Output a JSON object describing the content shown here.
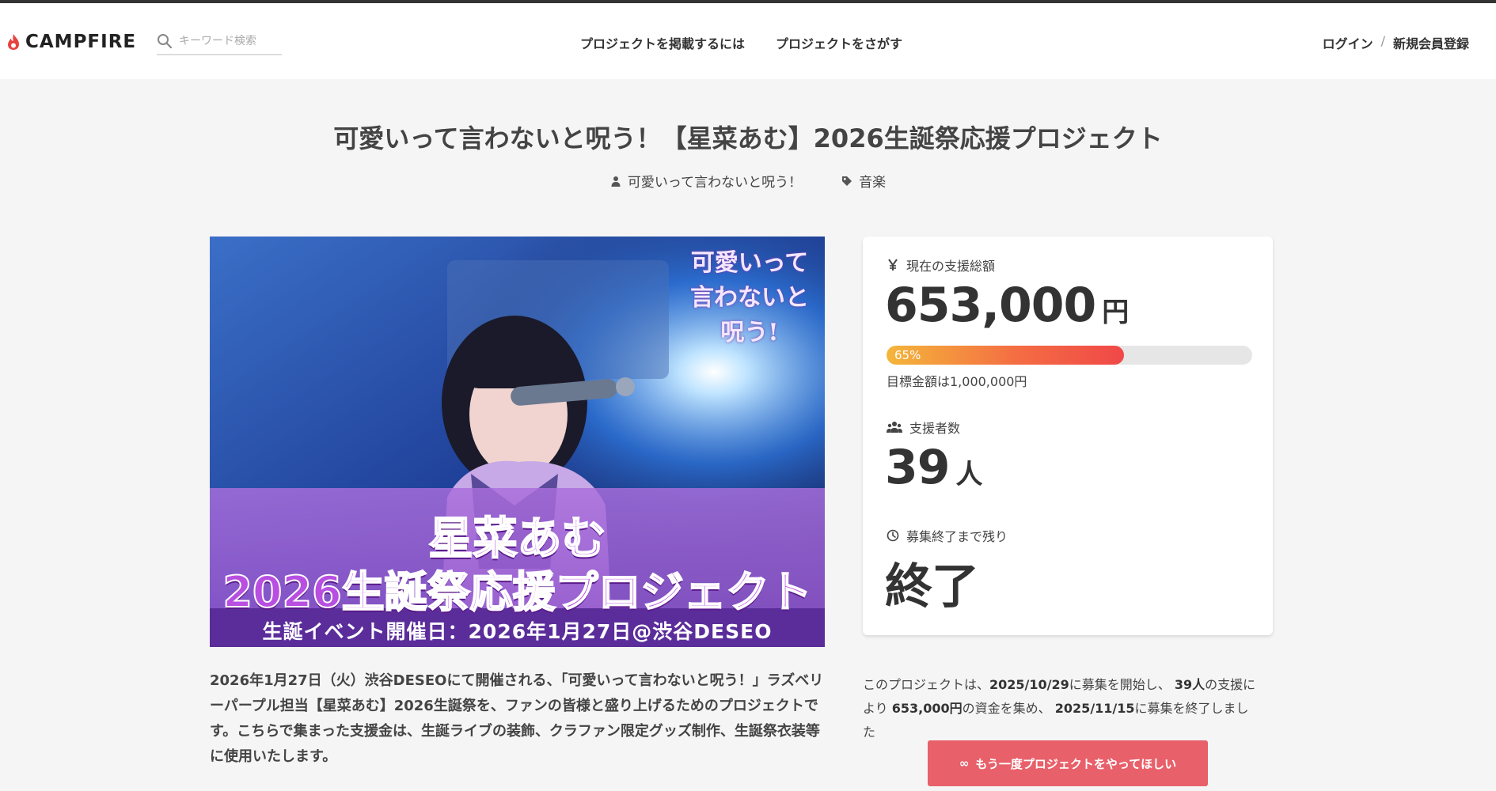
{
  "header": {
    "logo": "CAMPFIRE",
    "search_placeholder": "キーワード検索",
    "nav": [
      "プロジェクトを掲載するには",
      "プロジェクトをさがす"
    ],
    "login": "ログイン",
    "separator": "/",
    "signup": "新規会員登録"
  },
  "project": {
    "title": "可愛いって言わないと呪う！【星菜あむ】2026生誕祭応援プロジェクト",
    "owner": "可愛いって言わないと呪う！",
    "category": "音楽"
  },
  "hero": {
    "corner_logo": [
      "可愛いって",
      "言わないと",
      "呪う!"
    ],
    "line1": "星菜あむ",
    "line2": "2026生誕祭応援プロジェクト",
    "subline": "生誕イベント開催日：2026年1月27日@渋谷DESEO"
  },
  "stats": {
    "amount_label": "現在の支援総額",
    "amount_value": "653,000",
    "amount_unit": "円",
    "progress_percent": 65,
    "progress_label": "65%",
    "goal_text": "目標金額は1,000,000円",
    "backers_label": "支援者数",
    "backers_value": "39",
    "backers_unit": "人",
    "remaining_label": "募集終了まで残り",
    "remaining_value": "終了"
  },
  "description": "2026年1月27日（火）渋谷DESEOにて開催される、「可愛いって言わないと呪う！」ラズベリーパープル担当【星菜あむ】2026生誕祭を、ファンの皆様と盛り上げるためのプロジェクトです。こちらで集まった支援金は、生誕ライブの装飾、クラファン限定グッズ制作、生誕祭衣装等に使用いたします。",
  "summary": {
    "prefix": "このプロジェクトは、",
    "start_date": "2025/10/29",
    "mid1": "に募集を開始し、",
    "backers": "39人",
    "mid2": "の支援により",
    "amount": "653,000円",
    "mid3": "の資金を集め、",
    "end_date": "2025/11/15",
    "suffix": "に募集を終了しました"
  },
  "cta_label": "もう一度プロジェクトをやってほしい",
  "colors": {
    "accent": "#e8606a",
    "progress_start": "#f4b63a",
    "progress_end": "#f04848"
  }
}
